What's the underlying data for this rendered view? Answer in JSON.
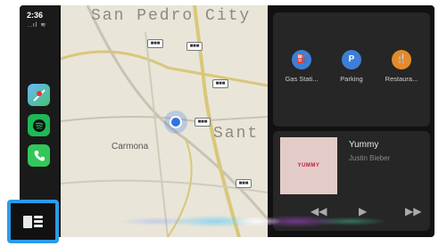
{
  "status": {
    "time": "2:36",
    "signal": "..ıl ≋"
  },
  "apps": [
    {
      "name": "maps",
      "icon": "maps-icon"
    },
    {
      "name": "spotify",
      "icon": "spotify-icon"
    },
    {
      "name": "phone",
      "icon": "phone-icon"
    }
  ],
  "dashboard_button": {
    "icon": "dashboard-icon"
  },
  "map": {
    "city_top": "San Pedro City",
    "city_right": "Sant",
    "place": "Carmona",
    "road_shields": [
      "■■■",
      "■■■",
      "■■■",
      "■■■",
      "■■■"
    ]
  },
  "pois": [
    {
      "label": "Gas Stati...",
      "glyph": "⛽",
      "color": "#3d7fd8"
    },
    {
      "label": "Parking",
      "glyph": "P",
      "color": "#3d7fd8"
    },
    {
      "label": "Restaura...",
      "glyph": "🍴",
      "color": "#e58a2c"
    }
  ],
  "now_playing": {
    "title": "Yummy",
    "artist": "Justin Bieber",
    "album_art_text": "YUMMY"
  },
  "controls": {
    "prev": "◀◀",
    "play": "▶",
    "next": "▶▶"
  },
  "colors": {
    "highlight": "#2b9be8",
    "panel": "#262626",
    "map_bg": "#e9e5d8"
  }
}
